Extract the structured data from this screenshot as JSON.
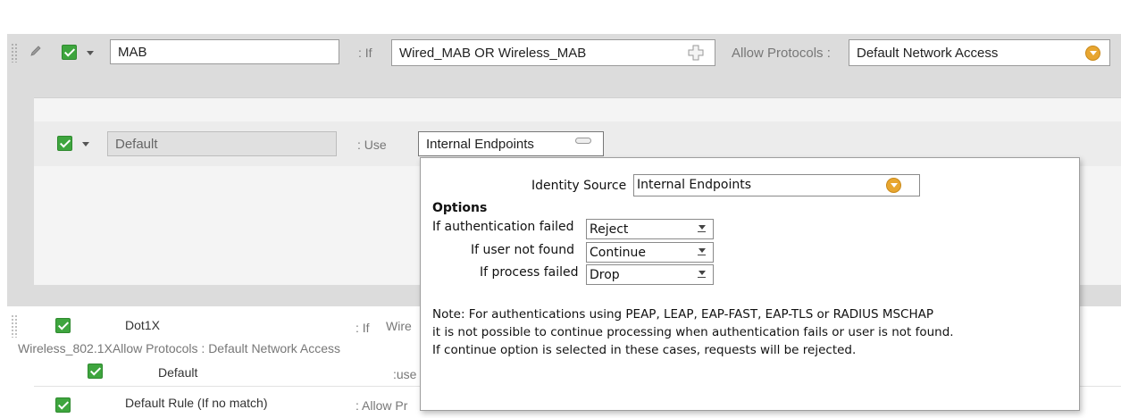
{
  "mab_rule": {
    "name_value": "MAB",
    "if_label": ": If",
    "condition_value": "Wired_MAB OR Wireless_MAB",
    "allow_protocols_label": "Allow Protocols :",
    "allow_protocols_value": "Default Network Access"
  },
  "inner_rule": {
    "name_value": "Default",
    "use_label": ": Use",
    "use_value": "Internal Endpoints"
  },
  "popup": {
    "identity_source_label": "Identity Source",
    "identity_source_value": "Internal Endpoints",
    "options_heading": "Options",
    "auth_failed_label": "If authentication failed",
    "auth_failed_value": "Reject",
    "user_not_found_label": "If user not found",
    "user_not_found_value": "Continue",
    "process_failed_label": "If process failed",
    "process_failed_value": "Drop",
    "note_line1": "Note: For authentications using PEAP, LEAP, EAP-FAST, EAP-TLS or RADIUS MSCHAP",
    "note_line2": "it is not possible to continue processing when authentication fails or user is not found.",
    "note_line3": "If continue option is selected in these cases, requests will be rejected."
  },
  "dot1x_rule": {
    "name": "Dot1X",
    "if_label": ": If",
    "condition_partial": "Wire",
    "line2": "Wireless_802.1XAllow Protocols  :  Default Network Access",
    "sub_name": "Default",
    "sub_use_label": ":use"
  },
  "default_rule": {
    "name": "Default Rule (If no match)",
    "allow_label": ": Allow Pr"
  },
  "colors": {
    "check_green": "#3ea53e",
    "panel_gray": "#dcdcdc",
    "dropdown_orange": "#e8a630"
  }
}
